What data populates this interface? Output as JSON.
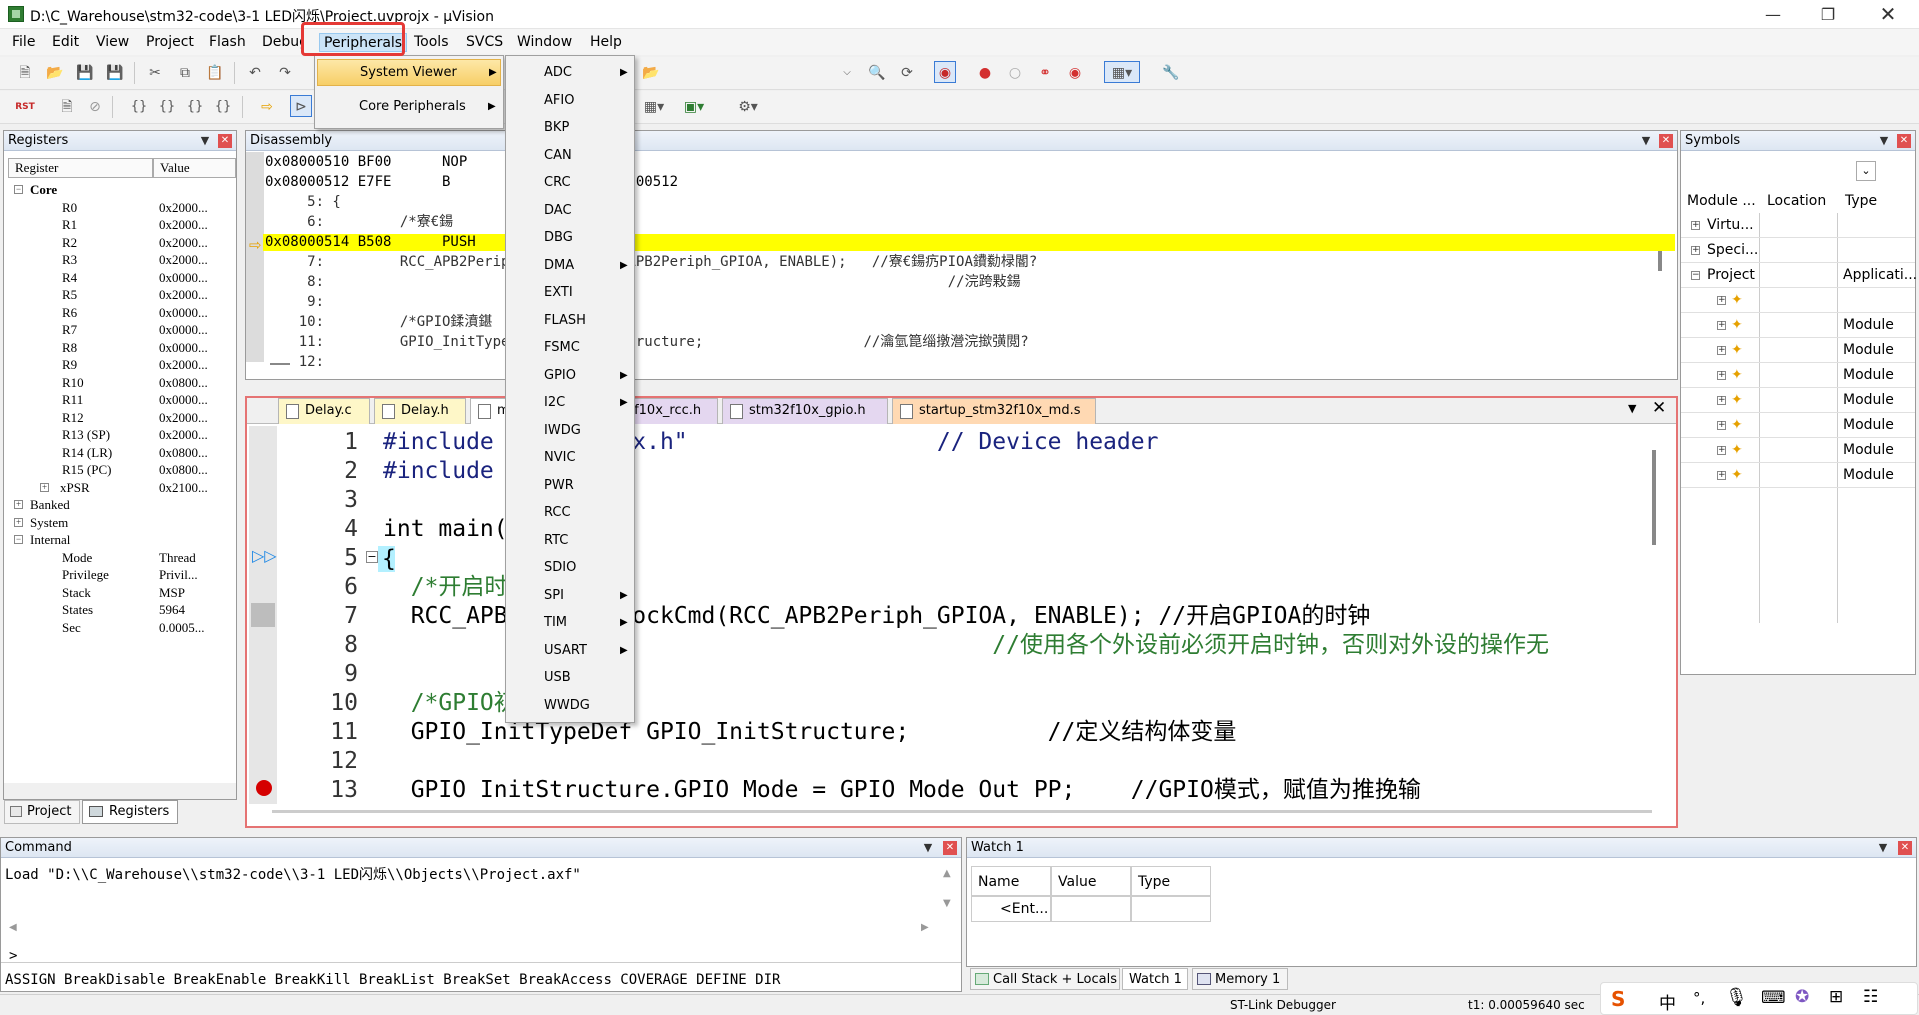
{
  "window": {
    "title": "D:\\C_Warehouse\\stm32-code\\3-1 LED闪烁\\Project.uvprojx - µVision"
  },
  "menubar": [
    "File",
    "Edit",
    "View",
    "Project",
    "Flash",
    "Debug",
    "Peripherals",
    "Tools",
    "SVCS",
    "Window",
    "Help"
  ],
  "peripherals_menu": {
    "items": [
      "System Viewer",
      "Core Peripherals"
    ]
  },
  "system_viewer_menu": {
    "items": [
      {
        "label": "ADC",
        "submenu": true
      },
      {
        "label": "AFIO",
        "submenu": false
      },
      {
        "label": "BKP",
        "submenu": false
      },
      {
        "label": "CAN",
        "submenu": false
      },
      {
        "label": "CRC",
        "submenu": false
      },
      {
        "label": "DAC",
        "submenu": false
      },
      {
        "label": "DBG",
        "submenu": false
      },
      {
        "label": "DMA",
        "submenu": true
      },
      {
        "label": "EXTI",
        "submenu": false
      },
      {
        "label": "FLASH",
        "submenu": false
      },
      {
        "label": "FSMC",
        "submenu": false
      },
      {
        "label": "GPIO",
        "submenu": true
      },
      {
        "label": "I2C",
        "submenu": true
      },
      {
        "label": "IWDG",
        "submenu": false
      },
      {
        "label": "NVIC",
        "submenu": false
      },
      {
        "label": "PWR",
        "submenu": false
      },
      {
        "label": "RCC",
        "submenu": false
      },
      {
        "label": "RTC",
        "submenu": false
      },
      {
        "label": "SDIO",
        "submenu": false
      },
      {
        "label": "SPI",
        "submenu": true
      },
      {
        "label": "TIM",
        "submenu": true
      },
      {
        "label": "USART",
        "submenu": true
      },
      {
        "label": "USB",
        "submenu": false
      },
      {
        "label": "WWDG",
        "submenu": false
      }
    ]
  },
  "registers_panel": {
    "title": "Registers",
    "col_register": "Register",
    "col_value": "Value",
    "rows": [
      {
        "name": "Core",
        "value": "",
        "level": 0,
        "toggle": "−",
        "bold": true
      },
      {
        "name": "R0",
        "value": "0x2000...",
        "level": 2
      },
      {
        "name": "R1",
        "value": "0x2000...",
        "level": 2
      },
      {
        "name": "R2",
        "value": "0x2000...",
        "level": 2
      },
      {
        "name": "R3",
        "value": "0x2000...",
        "level": 2
      },
      {
        "name": "R4",
        "value": "0x0000...",
        "level": 2
      },
      {
        "name": "R5",
        "value": "0x2000...",
        "level": 2
      },
      {
        "name": "R6",
        "value": "0x0000...",
        "level": 2
      },
      {
        "name": "R7",
        "value": "0x0000...",
        "level": 2
      },
      {
        "name": "R8",
        "value": "0x0000...",
        "level": 2
      },
      {
        "name": "R9",
        "value": "0x2000...",
        "level": 2
      },
      {
        "name": "R10",
        "value": "0x0800...",
        "level": 2
      },
      {
        "name": "R11",
        "value": "0x0000...",
        "level": 2
      },
      {
        "name": "R12",
        "value": "0x2000...",
        "level": 2
      },
      {
        "name": "R13 (SP)",
        "value": "0x2000...",
        "level": 2
      },
      {
        "name": "R14 (LR)",
        "value": "0x0800...",
        "level": 2
      },
      {
        "name": "R15 (PC)",
        "value": "0x0800...",
        "level": 2
      },
      {
        "name": "xPSR",
        "value": "0x2100...",
        "level": 1,
        "toggle": "+"
      },
      {
        "name": "Banked",
        "value": "",
        "level": 0,
        "toggle": "+"
      },
      {
        "name": "System",
        "value": "",
        "level": 0,
        "toggle": "+"
      },
      {
        "name": "Internal",
        "value": "",
        "level": 0,
        "toggle": "−"
      },
      {
        "name": "Mode",
        "value": "Thread",
        "level": 2
      },
      {
        "name": "Privilege",
        "value": "Privil...",
        "level": 2
      },
      {
        "name": "Stack",
        "value": "MSP",
        "level": 2
      },
      {
        "name": "States",
        "value": "5964",
        "level": 2
      },
      {
        "name": "Sec",
        "value": "0.0005...",
        "level": 2
      }
    ],
    "tab_project": "Project",
    "tab_registers": "Registers"
  },
  "disassembly_panel": {
    "title": "Disassembly",
    "lines": [
      {
        "text": "0x08000510 BF00      NOP",
        "current": false
      },
      {
        "text": "0x08000512 E7FE      B                 0x08000512",
        "current": false
      },
      {
        "text": "     5: {",
        "current": false
      },
      {
        "text": "     6:         /*寮€鍚",
        "current": false
      },
      {
        "text": "0x08000514 B508      PUSH      {r3,lr}",
        "current": true
      },
      {
        "text": "     7:         RCC_APB2PeriphClockCmd(RCC_APB2Periph_GPIOA, ENABLE);   //寮€鍚疓PIOA鐨勬椂閽?",
        "current": false
      },
      {
        "text": "     8:                                                                          //浣跨敤鍚",
        "current": false
      },
      {
        "text": "     9:",
        "current": false
      },
      {
        "text": "    10:         /*GPIO鍒濆鍖",
        "current": false
      },
      {
        "text": "    11:         GPIO_InitTypeDef GPIO_InitStructure;                   //瀹氫箟缁撴瀯浣撳彉閲?",
        "current": false
      },
      {
        "text": "    12:",
        "current": false
      }
    ]
  },
  "editor": {
    "tabs": [
      "Delay.c",
      "Delay.h",
      "main.c",
      "stm32f10x_rcc.h",
      "stm32f10x_gpio.h",
      "startup_stm32f10x_md.s"
    ],
    "lines": [
      {
        "n": "1",
        "text": "#include \"stm32f10x.h\"                  // Device header"
      },
      {
        "n": "2",
        "text": "#include \"Delay.h\""
      },
      {
        "n": "3",
        "text": ""
      },
      {
        "n": "4",
        "text": "int main(void)"
      },
      {
        "n": "5",
        "text": "{"
      },
      {
        "n": "6",
        "text": "  /*开启时钟*/"
      },
      {
        "n": "7",
        "text": "  RCC_APB2PeriphClockCmd(RCC_APB2Periph_GPIOA, ENABLE); //开启GPIOA的时钟"
      },
      {
        "n": "8",
        "text": "                                            //使用各个外设前必须开启时钟，否则对外设的操作无"
      },
      {
        "n": "9",
        "text": ""
      },
      {
        "n": "10",
        "text": "  /*GPIO初始化*/"
      },
      {
        "n": "11",
        "text": "  GPIO_InitTypeDef GPIO_InitStructure;          //定义结构体变量"
      },
      {
        "n": "12",
        "text": ""
      },
      {
        "n": "13",
        "text": "  GPIO_InitStructure.GPIO_Mode = GPIO_Mode_Out_PP;    //GPIO模式，赋值为推挽输"
      }
    ]
  },
  "symbols_panel": {
    "title": "Symbols",
    "cols": [
      "Module ...",
      "Location",
      "Type"
    ],
    "rows": [
      {
        "name": "Virtu...",
        "type": "",
        "level": 0
      },
      {
        "name": "Speci...",
        "type": "",
        "level": 0
      },
      {
        "name": "Project",
        "type": "Applicati...",
        "level": 0
      },
      {
        "name": "",
        "type": "",
        "level": 1
      },
      {
        "name": "",
        "type": "Module",
        "level": 1
      },
      {
        "name": "",
        "type": "Module",
        "level": 1
      },
      {
        "name": "",
        "type": "Module",
        "level": 1
      },
      {
        "name": "",
        "type": "Module",
        "level": 1
      },
      {
        "name": "",
        "type": "Module",
        "level": 1
      },
      {
        "name": "",
        "type": "Module",
        "level": 1
      },
      {
        "name": "",
        "type": "Module",
        "level": 1
      }
    ]
  },
  "command_panel": {
    "title": "Command",
    "output": "Load \"D:\\\\C_Warehouse\\\\stm32-code\\\\3-1 LED闪烁\\\\Objects\\\\Project.axf\"",
    "prompt": ">",
    "hint": "ASSIGN BreakDisable BreakEnable BreakKill BreakList BreakSet BreakAccess COVERAGE DEFINE DIR"
  },
  "watch_panel": {
    "title": "Watch 1",
    "cols": [
      "Name",
      "Value",
      "Type"
    ],
    "entry": "<Ent...",
    "tabs": [
      "Call Stack + Locals",
      "Watch 1",
      "Memory 1"
    ]
  },
  "statusbar": {
    "debugger": "ST-Link Debugger",
    "time": "t1: 0.00059640 sec"
  },
  "tray": {
    "ime": "中"
  }
}
